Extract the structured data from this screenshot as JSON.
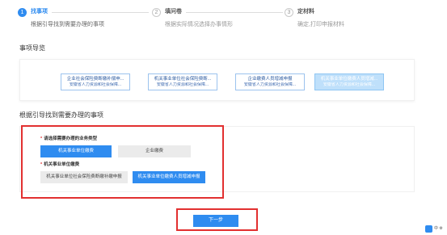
{
  "steps": [
    {
      "num": "1",
      "title": "找事项",
      "desc": "根据引导找到需要办理的事项"
    },
    {
      "num": "2",
      "title": "填问卷",
      "desc": "根据实际情况选择办事情形"
    },
    {
      "num": "3",
      "title": "定材料",
      "desc": "确定,打印申报材料"
    }
  ],
  "guide": {
    "heading": "事项导览",
    "cards": [
      {
        "title": "企业社会保险费断缴补偿申...",
        "subtitle": "安徽省人力资源和社会保障..."
      },
      {
        "title": "机关事业单位社会保险费断...",
        "subtitle": "安徽省人力资源和社会保障..."
      },
      {
        "title": "企业缴费人员增减申报",
        "subtitle": "安徽省人力资源和社会保障..."
      },
      {
        "title": "机关事业单位缴费人员增减...",
        "subtitle": "安徽省人力资源和社会保障..."
      }
    ]
  },
  "finder": {
    "heading": "根据引导找到需要办理的事项",
    "q1": {
      "label": "请选择需要办理的业务类型",
      "options": [
        "机关事业单位缴费",
        "企业缴费"
      ]
    },
    "q2": {
      "label": "机关事业单位缴费",
      "options": [
        "机关事业单位社会保险费断缴补缴申报",
        "机关事业单位缴费人员增减申报"
      ]
    }
  },
  "next_label": "下一步",
  "widget_text": "中 ⚙"
}
